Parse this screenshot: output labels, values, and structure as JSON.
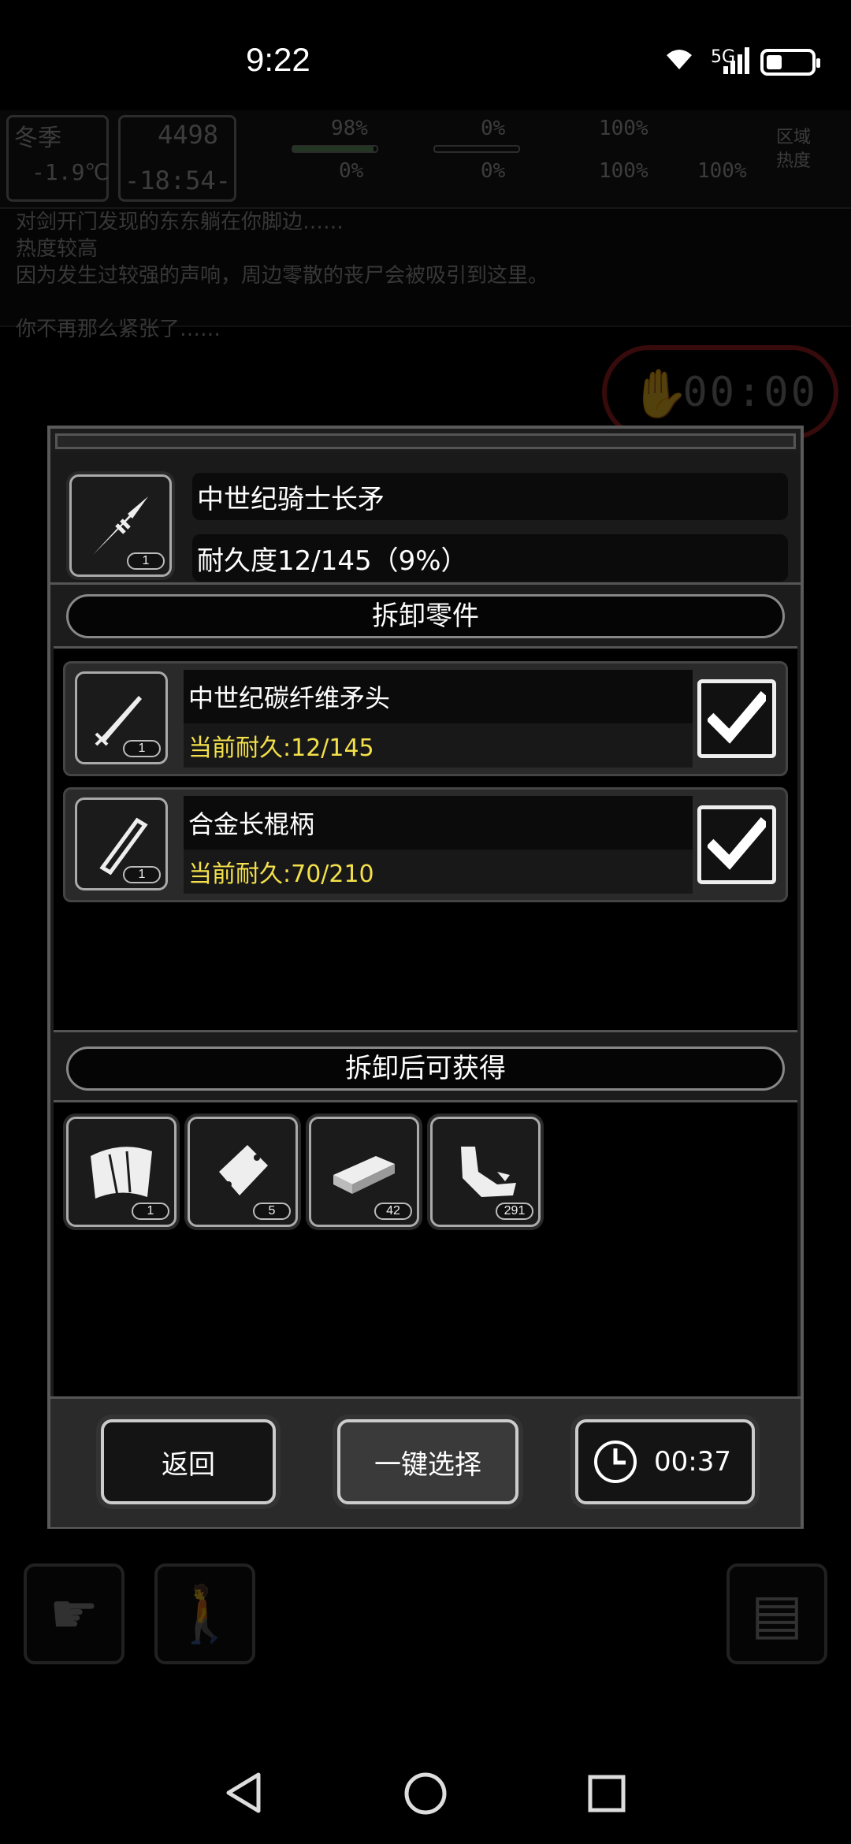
{
  "status_bar": {
    "time": "9:22",
    "network": "5G",
    "battery_level": 0.35
  },
  "hud": {
    "season": "冬季",
    "temperature": "-1.9℃",
    "day": "4498",
    "clock": "-18:54-",
    "health_pct": "98%",
    "hunger_pct": "0%",
    "stat3_pct": "100%",
    "bleed_pct": "0%",
    "blood_pct": "0%",
    "mood_pct": "100%",
    "energy_pct": "100%",
    "zone_label": "区域",
    "heat_label": "热度"
  },
  "log": {
    "lines": [
      "对剑开门发现的东东躺在你脚边……",
      "热度较高",
      "因为发生过较强的声响，周边零散的丧尸会被吸引到这里。",
      "",
      "你不再那么紧张了……"
    ]
  },
  "alarm": {
    "timer": "00:00"
  },
  "dialog": {
    "item": {
      "name": "中世纪骑士长矛",
      "durability": "耐久度12/145（9%）",
      "count": "1",
      "icon": "spear-icon"
    },
    "parts_title": "拆卸零件",
    "parts": [
      {
        "name": "中世纪碳纤维矛头",
        "durability": "当前耐久:12/145",
        "count": "1",
        "icon": "spearhead-icon",
        "checked": true
      },
      {
        "name": "合金长棍柄",
        "durability": "当前耐久:70/210",
        "count": "1",
        "icon": "staff-handle-icon",
        "checked": true
      }
    ],
    "gain_title": "拆卸后可获得",
    "gains": [
      {
        "icon": "cloth-icon",
        "count": "1"
      },
      {
        "icon": "plastic-sheet-icon",
        "count": "5"
      },
      {
        "icon": "metal-bar-icon",
        "count": "42"
      },
      {
        "icon": "scrap-icon",
        "count": "291"
      }
    ],
    "buttons": {
      "back": "返回",
      "select_all": "一键选择",
      "timer": "00:37"
    }
  },
  "colors": {
    "durability_text": "#f3e04a",
    "background": "#000000"
  }
}
